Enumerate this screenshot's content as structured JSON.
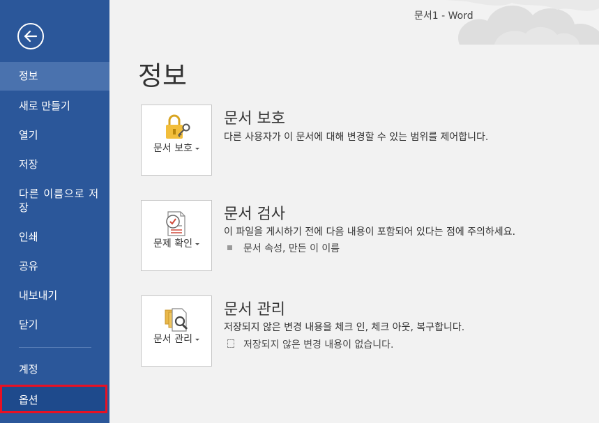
{
  "window": {
    "title": "문서1 - Word"
  },
  "page": {
    "title": "정보"
  },
  "sidebar": {
    "back_icon": "arrow-left-icon",
    "items": [
      {
        "label": "정보",
        "active": true
      },
      {
        "label": "새로 만들기"
      },
      {
        "label": "열기"
      },
      {
        "label": "저장"
      },
      {
        "label": "다른 이름으로 저장"
      },
      {
        "label": "인쇄"
      },
      {
        "label": "공유"
      },
      {
        "label": "내보내기"
      },
      {
        "label": "닫기"
      },
      {
        "label": "계정"
      },
      {
        "label": "옵션"
      }
    ]
  },
  "sections": {
    "protect": {
      "button_label": "문서 보호",
      "icon": "lock-key-icon",
      "title": "문서 보호",
      "desc": "다른 사용자가 이 문서에 대해 변경할 수 있는 범위를 제어합니다."
    },
    "inspect": {
      "button_label": "문제 확인",
      "icon": "inspect-document-icon",
      "title": "문서 검사",
      "desc": "이 파일을 게시하기 전에 다음 내용이 포함되어 있다는 점에 주의하세요.",
      "bullet": "문서 속성, 만든 이 이름"
    },
    "manage": {
      "button_label": "문서 관리",
      "icon": "manage-document-icon",
      "title": "문서 관리",
      "desc": "저장되지 않은 변경 내용을 체크 인, 체크 아웃, 복구합니다.",
      "bullet": "저장되지 않은 변경 내용이 없습니다."
    }
  },
  "colors": {
    "sidebar": "#2b579a",
    "sidebar_active": "#4a72ae",
    "highlight_border": "#e81123"
  }
}
